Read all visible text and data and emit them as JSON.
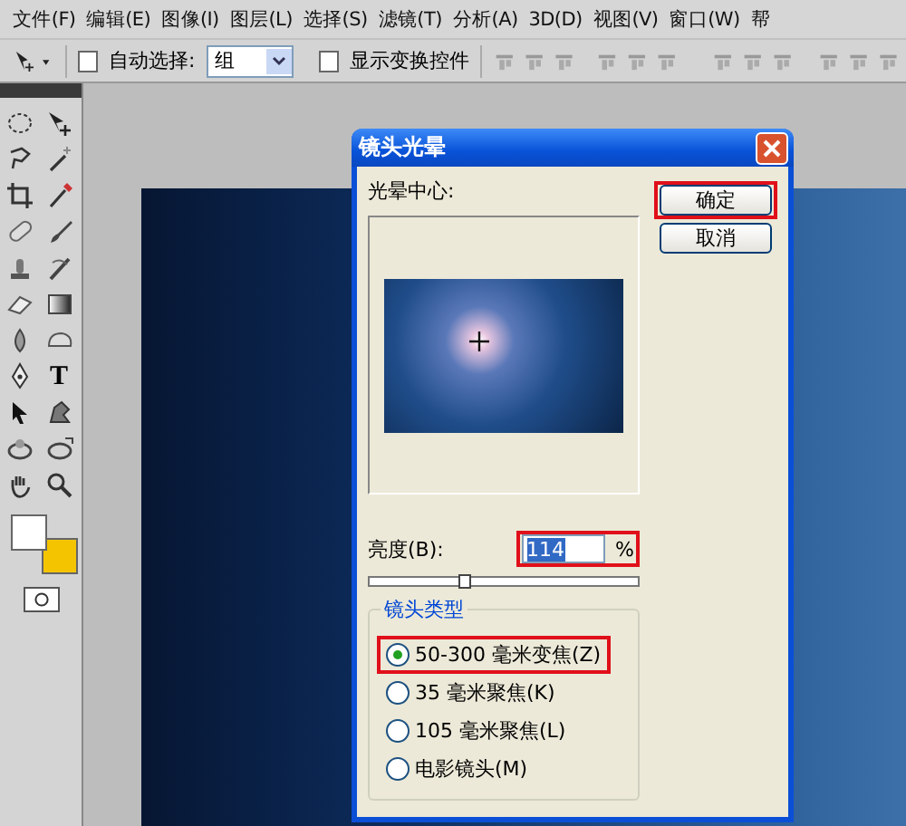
{
  "menu_bar": {
    "items": [
      "文件(F)",
      "编辑(E)",
      "图像(I)",
      "图层(L)",
      "选择(S)",
      "滤镜(T)",
      "分析(A)",
      "3D(D)",
      "视图(V)",
      "窗口(W)",
      "帮"
    ]
  },
  "options_bar": {
    "auto_select": {
      "label": "自动选择:",
      "checked": false
    },
    "auto_select_target": {
      "value": "组"
    },
    "show_transform": {
      "label": "显示变换控件",
      "checked": false
    }
  },
  "toolbox": {
    "text_tool_label": "T",
    "swatches": [
      {
        "color": "#ffffff"
      },
      {
        "color": "#f5c400"
      }
    ]
  },
  "dialog": {
    "title": "镜头光晕",
    "center_label": "光晕中心:",
    "buttons": [
      {
        "label": "确定",
        "highlighted": true
      },
      {
        "label": "取消",
        "highlighted": false
      }
    ],
    "brightness": {
      "label": "亮度(B):",
      "value": "114",
      "unit": "%",
      "level": 0.36,
      "highlighted": true
    },
    "lens_type": {
      "title": "镜头类型",
      "options": [
        {
          "label": "50-300 毫米变焦(Z)",
          "selected": true,
          "highlighted": true
        },
        {
          "label": "35 毫米聚焦(K)",
          "selected": false,
          "highlighted": false
        },
        {
          "label": "105 毫米聚焦(L)",
          "selected": false,
          "highlighted": false
        },
        {
          "label": "电影镜头(M)",
          "selected": false,
          "highlighted": false
        }
      ]
    }
  }
}
